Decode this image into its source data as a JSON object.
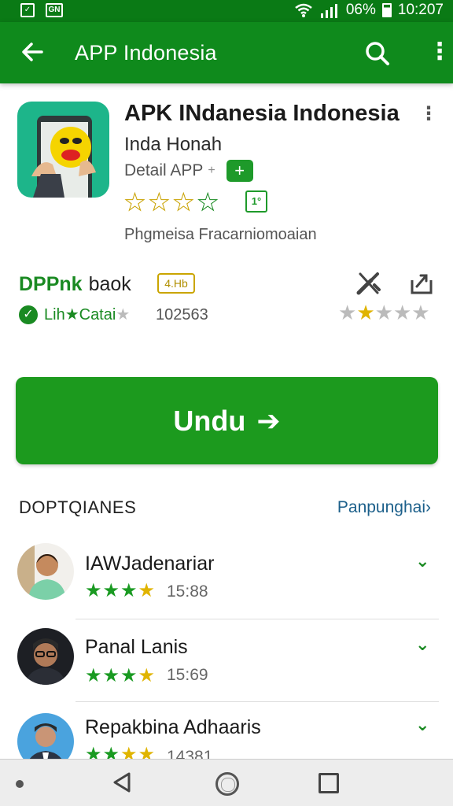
{
  "status_bar": {
    "carrier_icons": [
      "notification-icon",
      "sim-icon"
    ],
    "sim_label": "GN",
    "battery": "06%",
    "time": "10:207"
  },
  "app_bar": {
    "title": "APP Indonesia"
  },
  "app": {
    "name": "APK INdanesia Indonesia",
    "developer": "Inda Honah",
    "category": "Detail  APP",
    "category_suffix": "+",
    "badge_symbol": "+",
    "rating_stars": 4,
    "rating_box": "1°",
    "description": "Phgmeisa Fracarniomoaian"
  },
  "stats": {
    "price_label": "DPPnk",
    "price_suffix": "baok",
    "size_badge": "4.Hb",
    "check_label": "Lih★Catai",
    "downloads": "102563",
    "right_stars": [
      false,
      true,
      false,
      false,
      false
    ]
  },
  "install_button": {
    "label": "Undu",
    "arrow": "➔"
  },
  "section": {
    "title": "DOPTQIANES",
    "link": "Panpunghai›"
  },
  "list": [
    {
      "name": "IAWJadenariar",
      "time": "15:88",
      "stars": 4
    },
    {
      "name": "Panal Lanis",
      "time": "15:69",
      "stars": 4
    },
    {
      "name": "Repakbina Adhaaris",
      "time": "14381",
      "stars": 4
    }
  ],
  "colors": {
    "primary": "#0f8a1c",
    "accent": "#1c9a1e",
    "link": "#1b5f8a"
  }
}
